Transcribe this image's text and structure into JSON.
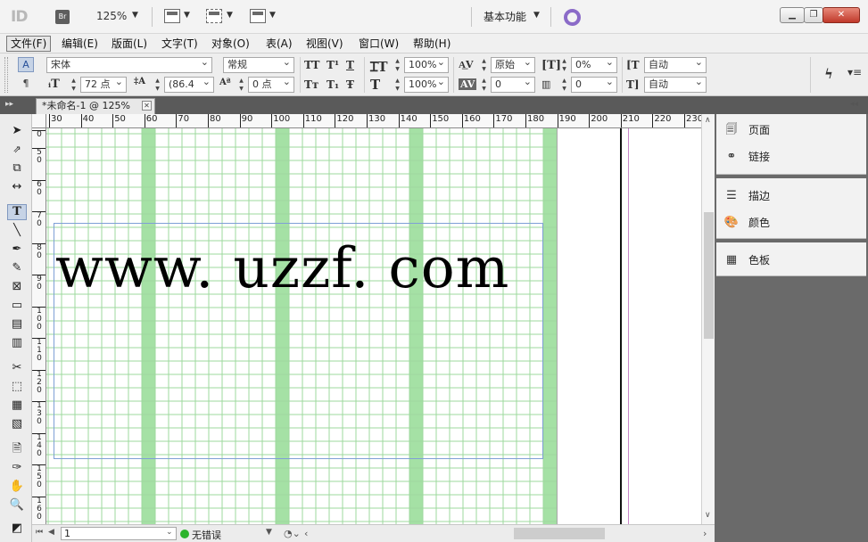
{
  "titlebar": {
    "logo": "ID",
    "bridge": "Br",
    "zoom": "125%",
    "workspace": "基本功能"
  },
  "menu": {
    "items": [
      "文件(F)",
      "编辑(E)",
      "版面(L)",
      "文字(T)",
      "对象(O)",
      "表(A)",
      "视图(V)",
      "窗口(W)",
      "帮助(H)"
    ],
    "active_index": 0
  },
  "control": {
    "font_family": "宋体",
    "font_style": "常规",
    "font_size": "72 点",
    "leading": "(86.4",
    "baseline_shift": "0 点",
    "vertical_scale": "100%",
    "horizontal_scale": "100%",
    "kerning": "原始",
    "tracking": "0",
    "tsume": "0%",
    "grid_space": "0",
    "auto_1": "自动",
    "auto_2": "自动",
    "glyphs": {
      "all_caps": "TT",
      "superscript": "T¹",
      "underline": "T",
      "small_caps": "Tт",
      "subscript": "T₁",
      "strikethrough": "Ŧ"
    }
  },
  "document": {
    "tab_title": "*未命名-1 @ 125%",
    "tab_close": "✕",
    "text_content": "www. uzzf. com"
  },
  "ruler": {
    "top_labels": [
      "30",
      "40",
      "50",
      "60",
      "70",
      "80",
      "90",
      "100",
      "110",
      "120",
      "130",
      "140",
      "150",
      "160",
      "170",
      "180",
      "190",
      "200",
      "210",
      "220",
      "230"
    ],
    "left_labels": [
      "0",
      "5\n0",
      "6\n0",
      "7\n0",
      "8\n0",
      "9\n0",
      "1\n0\n0",
      "1\n1\n0",
      "1\n2\n0",
      "1\n3\n0",
      "1\n4\n0",
      "1\n5\n0",
      "1\n6\n0"
    ]
  },
  "status": {
    "page": "1",
    "errors": "无错误"
  },
  "panels": {
    "group1": [
      {
        "label": "页面",
        "icon": "pages-icon"
      },
      {
        "label": "链接",
        "icon": "links-icon"
      }
    ],
    "group2": [
      {
        "label": "描边",
        "icon": "stroke-icon"
      },
      {
        "label": "颜色",
        "icon": "color-icon"
      }
    ],
    "group3": [
      {
        "label": "色板",
        "icon": "swatches-icon"
      }
    ]
  },
  "colors": {
    "grid_line": "#9ed89e",
    "grid_column": "#a5e1a5",
    "frame": "#7f9fd6",
    "accent_ring": "#8b6bc8"
  }
}
